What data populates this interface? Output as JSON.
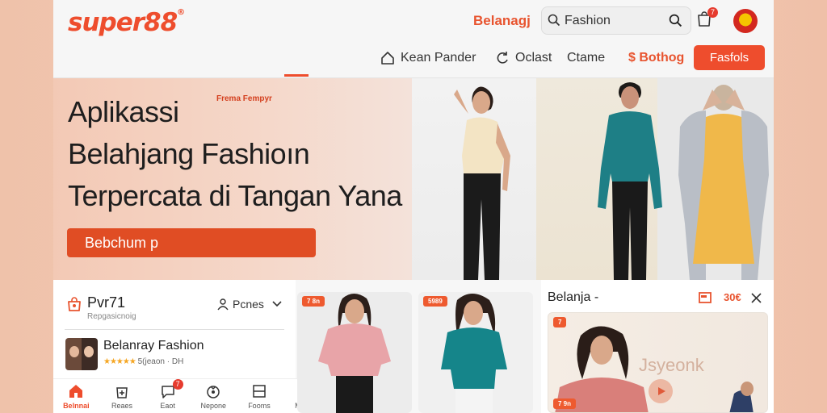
{
  "header": {
    "logo": "super88",
    "logo_mark": "®",
    "top_link": "Belanagj",
    "search_value": "Fashion",
    "cart_badge": "7",
    "nav": [
      {
        "label": "Kean Pander",
        "icon": "home-outline-icon"
      },
      {
        "label": "Oclast",
        "icon": "refresh-icon"
      },
      {
        "label": "Ctame",
        "icon": ""
      },
      {
        "label": "$ Bothog",
        "icon": ""
      }
    ],
    "nav_button": "Fasfols"
  },
  "hero": {
    "small_label": "Frema Fempyr",
    "title_line1": "Aplikassi",
    "title_line2": "Belahjang Fashioın",
    "title_line3": "Terpercata di Tangan Yana",
    "cta": "Bebchum p"
  },
  "account": {
    "name": "Pvr71",
    "subtitle": "Repgasicnoig",
    "user_label": "Pcnes",
    "shop_name": "Belanray Fashion",
    "shop_rating_stars": "★★★★★",
    "shop_rating_text": "5(jeaon · DH"
  },
  "bottom_nav": [
    {
      "label": "Belnnai",
      "icon": "home-icon",
      "active": true
    },
    {
      "label": "Reaes",
      "icon": "add-bag-icon",
      "active": false
    },
    {
      "label": "Eaot",
      "icon": "chat-icon",
      "active": false,
      "badge": "7"
    },
    {
      "label": "Nepone",
      "icon": "gift-icon",
      "active": false
    },
    {
      "label": "Fooms",
      "icon": "layout-icon",
      "active": false
    },
    {
      "label": "Mamn",
      "icon": "grid-dots-icon",
      "active": false
    }
  ],
  "products": [
    {
      "tag": "7 8n"
    },
    {
      "tag": "5989"
    }
  ],
  "right_panel": {
    "title": "Belanja -",
    "price": "30€",
    "tag": "7",
    "overlay_text": "Jsyeonk",
    "footer_tag": "7 9n"
  },
  "colors": {
    "accent": "#ee4d2d",
    "background": "#f0c5ae"
  }
}
